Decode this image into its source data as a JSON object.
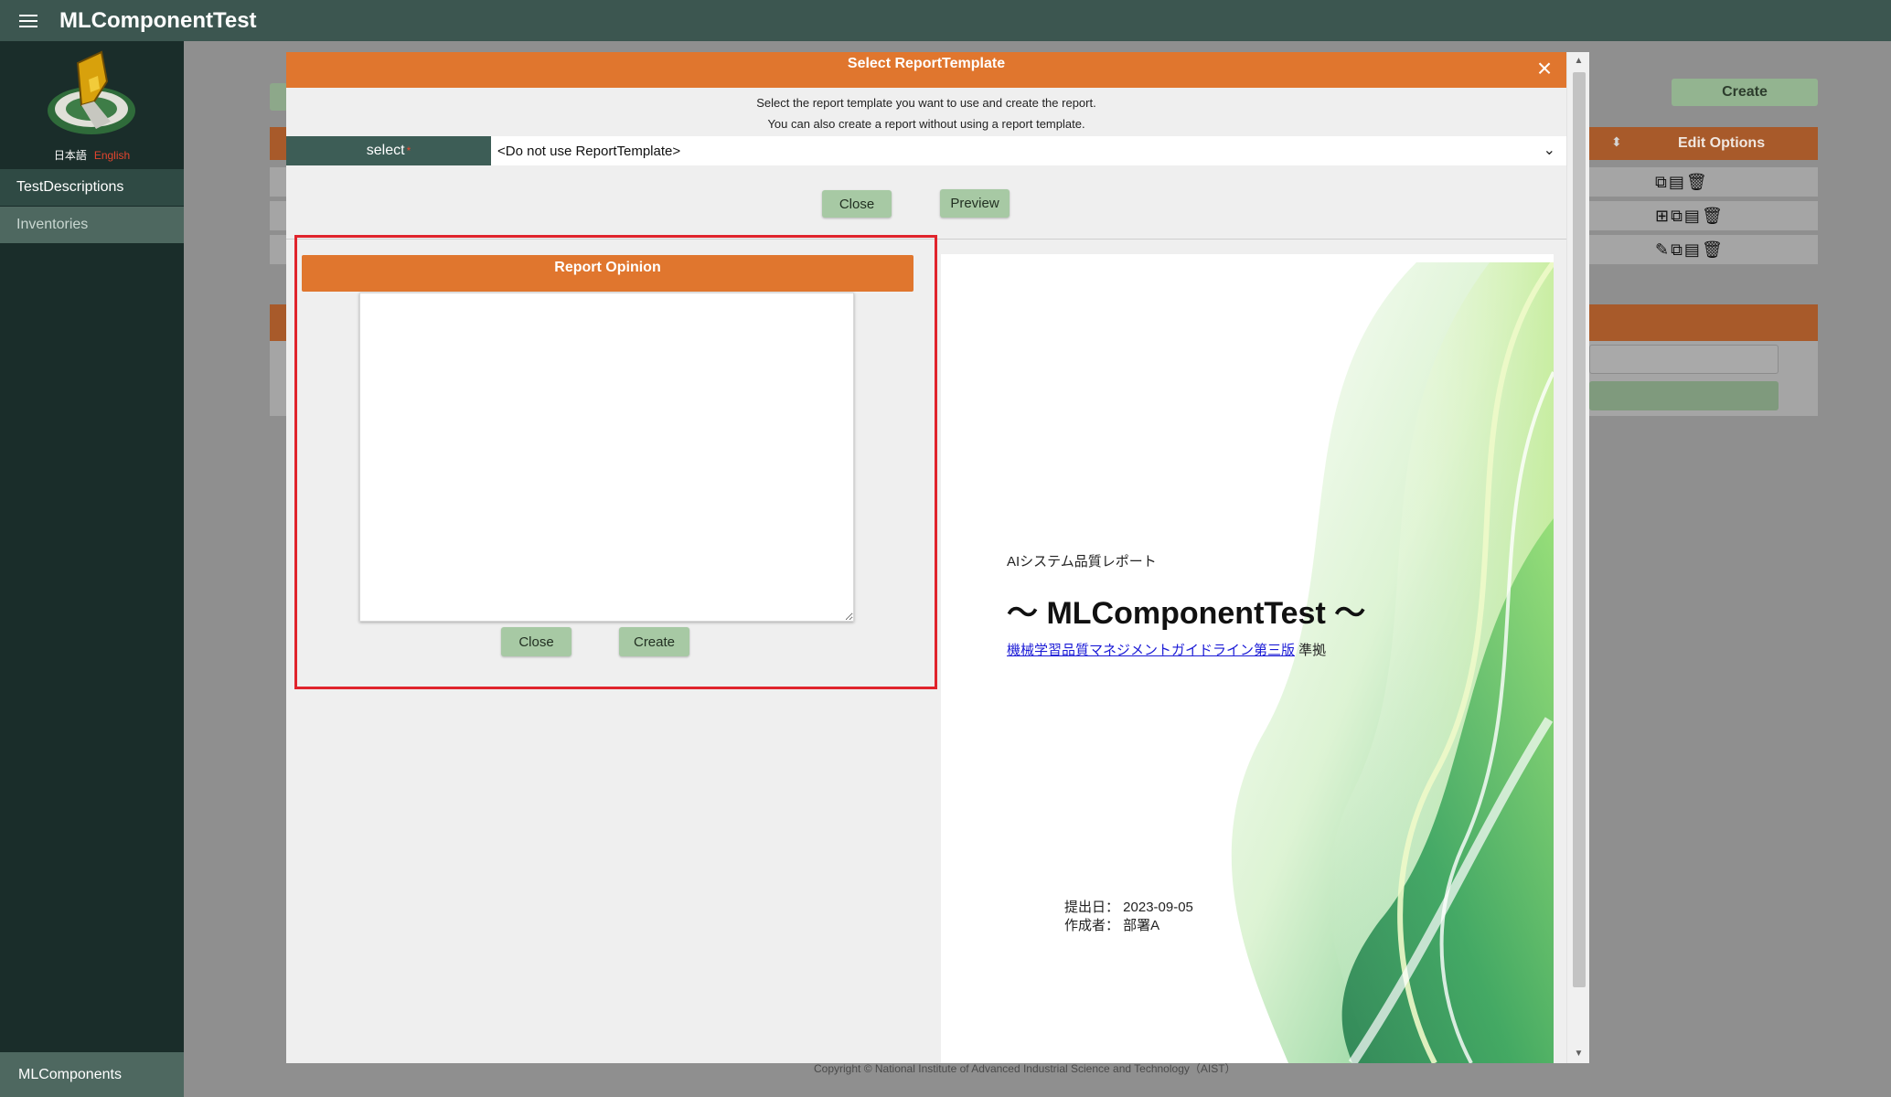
{
  "app": {
    "title": "MLComponentTest"
  },
  "sidebar": {
    "lang_ja": "日本語",
    "lang_en": "English",
    "items": [
      {
        "label": "TestDescriptions"
      },
      {
        "label": "Inventories"
      }
    ],
    "bottom_item": "MLComponents"
  },
  "background": {
    "create_label": "Create",
    "edit_options_label": "Edit Options",
    "footer": "Copyright © National Institute of Advanced Industrial Science and Technology（AIST）"
  },
  "modal": {
    "title": "Select ReportTemplate",
    "desc_line1": "Select the report template you want to use and create the report.",
    "desc_line2": "You can also create a report without using a report template.",
    "select_label": "select",
    "select_value": "<Do not use ReportTemplate>",
    "close_label": "Close",
    "preview_label": "Preview",
    "opinion": {
      "header": "Report Opinion",
      "text": "",
      "close_label": "Close",
      "create_label": "Create"
    },
    "preview": {
      "subtitle": "AIシステム品質レポート",
      "title": "～ MLComponentTest ～",
      "link_text": "機械学習品質マネジメントガイドライン第三版",
      "link_suffix": " 準拠",
      "date_line": "提出日： 2023-09-05",
      "author_line": "作成者： 部署A"
    }
  },
  "colors": {
    "topbar": "#3c5650",
    "sidebar": "#1a2d2a",
    "accent_orange": "#e0762e",
    "button_green": "#a7c9a4",
    "highlight_red": "#e0242c"
  }
}
